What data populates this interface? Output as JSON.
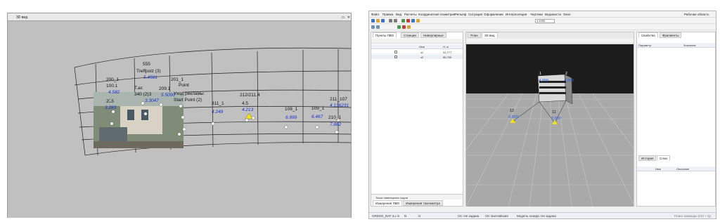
{
  "left_window": {
    "title": "3D вид",
    "min_glyph": "▭",
    "close_glyph": "✕",
    "labels": [
      {
        "text": "555"
      },
      {
        "text": "Treffpolz (3)"
      },
      {
        "text": "5.4581"
      },
      {
        "text": "200_1"
      },
      {
        "text": "100.1"
      },
      {
        "text": "4.582"
      },
      {
        "text": "201_1"
      },
      {
        "text": "Point"
      },
      {
        "text": "209.1"
      },
      {
        "text": "Т.ас"
      },
      {
        "text": "340 (2)3"
      },
      {
        "text": "5.5000"
      },
      {
        "text": "3.3047"
      },
      {
        "text": "Уход рекламы"
      },
      {
        "text": "Start Point (2)"
      },
      {
        "text": "205"
      },
      {
        "text": "3.283"
      },
      {
        "text": "311_1"
      },
      {
        "text": "4.249"
      },
      {
        "text": "212/211.4"
      },
      {
        "text": "4.213"
      },
      {
        "text": "4.5"
      },
      {
        "text": "108_1"
      },
      {
        "text": "6.999"
      },
      {
        "text": "109_1"
      },
      {
        "text": "6.467"
      },
      {
        "text": "211_107"
      },
      {
        "text": "4.136231"
      },
      {
        "text": "210_1"
      },
      {
        "text": "7.882"
      }
    ]
  },
  "right_app": {
    "window_label": "Рабочая область",
    "menu": [
      "Файл",
      "Правка",
      "Вид",
      "Расчеты",
      "Координатная геометрия",
      "Рельеф",
      "Ситуация",
      "Оформление",
      "Интерполяция",
      "Чертежи",
      "Ведомости",
      "Окно"
    ],
    "zoom_value": "1:1000",
    "left_panel": {
      "tabs": [
        "Пункты ПВО",
        "Станции",
        "Ниверлирные"
      ],
      "headers": [
        "Имя",
        "Н, м"
      ],
      "rows": [
        {
          "name": "з1",
          "h": "02,777"
        },
        {
          "name": "з2",
          "h": "56,700"
        }
      ],
      "bottom_label": "Точки нивелирных ходов",
      "bottom_tabs": [
        "Измерения ПВО",
        "Измерения тахеометра"
      ]
    },
    "center": {
      "tabs": [
        "План",
        "3D вид"
      ],
      "markers": [
        {
          "num": "1",
          "val": "4,999"
        },
        {
          "num": "2",
          "val": "4,999"
        },
        {
          "num": "12",
          "val": "0,000"
        },
        {
          "num": "11",
          "val": "0,000"
        }
      ]
    },
    "right_panel": {
      "tabs": [
        "Свойства",
        "Фрагменты"
      ],
      "headers": [
        "Параметр",
        "Значение"
      ],
      "layers_tabs": [
        "История",
        "Слои"
      ],
      "layers_headers": [
        "Имя",
        "Описание"
      ]
    },
    "status": {
      "file": "CREDO_DAT 3.x",
      "s": "S",
      "n": "N",
      "h": "H",
      "sk": "СК: Не задана",
      "bsk": "СК: Балтийская",
      "model": "Модель геоида: Не задана",
      "search": "Поиск команды (Ctrl + Q)"
    }
  },
  "colors": {
    "label_black": "#111111",
    "label_blue": "#1a2ecc",
    "marker_yellow": "#f2e21a",
    "grid_bg_top": "#1c1c1c",
    "grid_floor": "#a9a9a9"
  }
}
